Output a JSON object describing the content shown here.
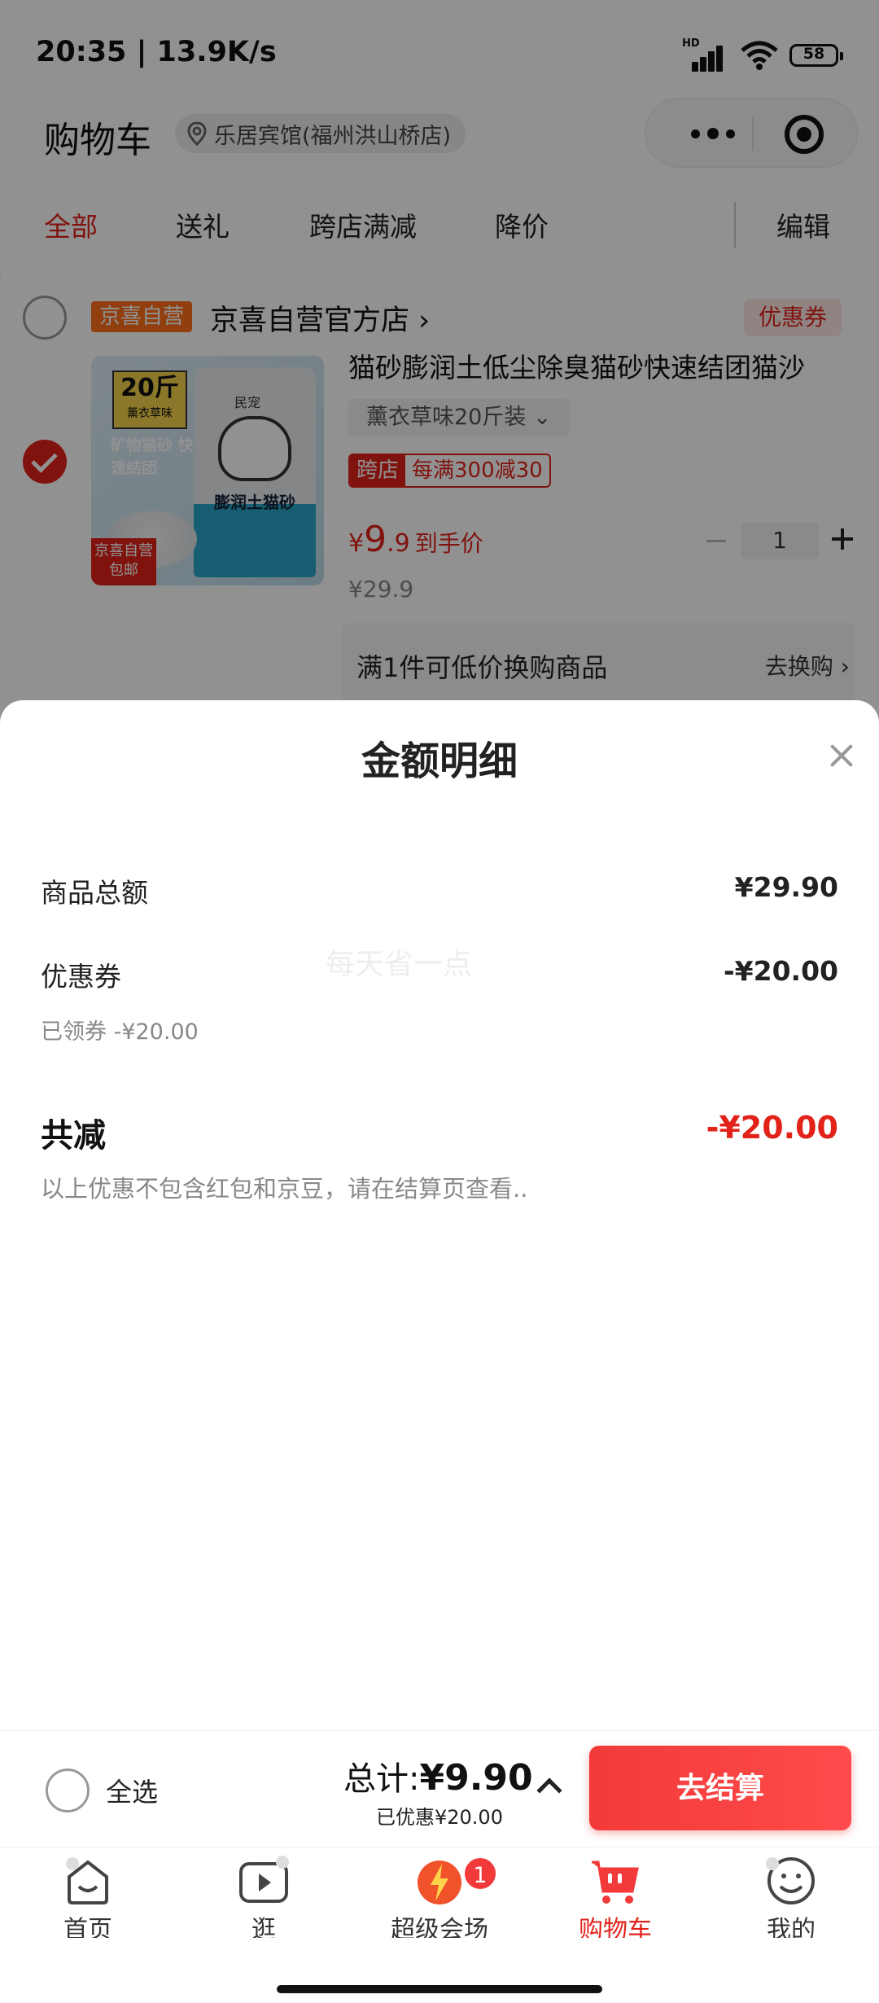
{
  "status_bar": {
    "time_speed": "20:35 | 13.9K/s",
    "hd": "HD",
    "battery": "58"
  },
  "header": {
    "title": "购物车",
    "address": "乐居宾馆(福州洪山桥店)"
  },
  "tabs": [
    {
      "label": "全部",
      "active": true
    },
    {
      "label": "送礼",
      "active": false
    },
    {
      "label": "跨店满减",
      "active": false
    },
    {
      "label": "降价",
      "active": false
    }
  ],
  "edit_label": "编辑",
  "store": {
    "tag": "京喜自营",
    "name": "京喜自营官方店 ›",
    "coupon_label": "优惠券"
  },
  "product": {
    "title": "猫砂膨润土低尘除臭猫砂快速结团猫沙",
    "spec": "薰衣草味20斤装 ⌄",
    "promo_tag": "跨店",
    "promo_text": "每满300减30",
    "price_symbol": "¥",
    "price_int": "9",
    "price_dec": ".9",
    "price_suffix": "到手价",
    "original_price": "¥29.9",
    "quantity": "1",
    "image_text": {
      "weight": "20斤",
      "flavor": "薰衣草味",
      "side_text": "矿物猫砂 快速结团",
      "brand": "民宠",
      "bag_title": "膨润土猫砂",
      "badge_top": "京喜自营",
      "badge_bottom": "包邮"
    }
  },
  "swap": {
    "text": "满1件可低价换购商品",
    "link": "去换购 ›"
  },
  "sheet": {
    "title": "金额明细",
    "goods_total_label": "商品总额",
    "goods_total_value": "¥29.90",
    "coupon_label": "优惠券",
    "coupon_value": "-¥20.00",
    "coupon_sub": "已领券 -¥20.00",
    "reduction_label": "共减",
    "reduction_value": "-¥20.00",
    "note": "以上优惠不包含红包和京豆，请在结算页查看..",
    "watermark": "每天省一点"
  },
  "checkout": {
    "select_all": "全选",
    "total_prefix": "总计:",
    "total_amount": "¥9.90",
    "saved": "已优惠¥20.00",
    "button": "去结算"
  },
  "nav": [
    {
      "label": "首页",
      "icon": "home-icon"
    },
    {
      "label": "逛",
      "icon": "play-icon"
    },
    {
      "label": "超级会场",
      "icon": "venue-icon",
      "badge": "1"
    },
    {
      "label": "购物车",
      "icon": "cart-icon",
      "active": true
    },
    {
      "label": "我的",
      "icon": "profile-icon"
    }
  ],
  "colors": {
    "accent": "#e2231a",
    "checkout_button": "#f23a3a",
    "store_tag": "#ff6f1c"
  }
}
